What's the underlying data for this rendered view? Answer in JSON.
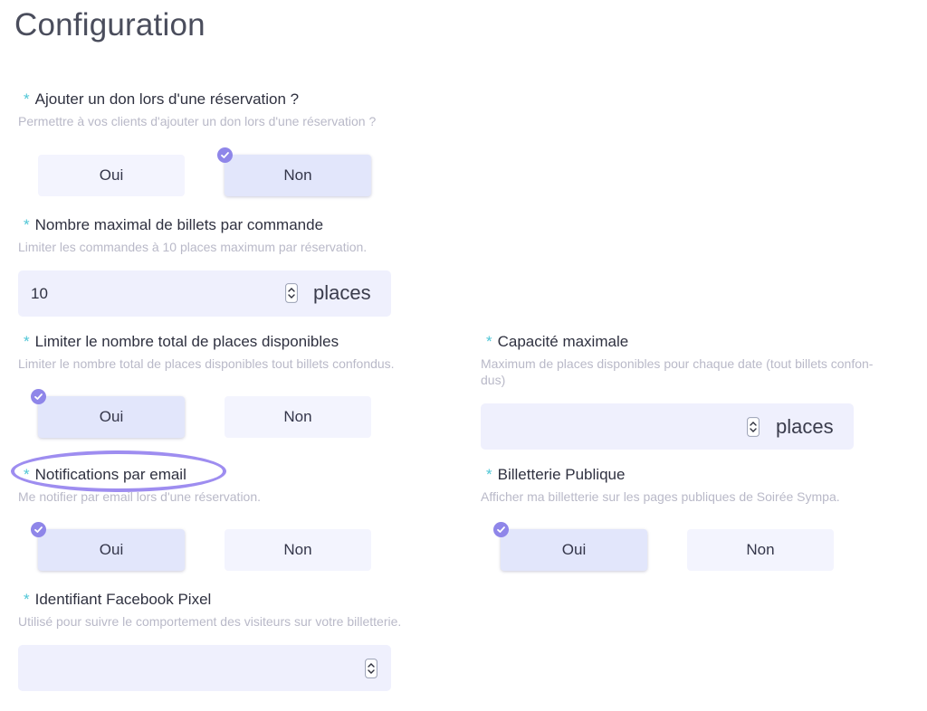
{
  "page": {
    "title": "Configuration"
  },
  "required_marker": "*",
  "donation": {
    "label": "Ajouter un don lors d'une réservation ?",
    "help": "Permettre à vos clients d'ajouter un don lors d'une réservation ?",
    "yes": "Oui",
    "no": "Non",
    "selected": "Non"
  },
  "max_tickets": {
    "label": "Nombre maximal de billets par commande",
    "help": "Limiter les commandes à 10 places maximum par réservation.",
    "value": "10",
    "unit": "places"
  },
  "limit_total": {
    "label": "Limiter le nombre total de places disponibles",
    "help": "Limiter le nombre total de places disponibles tout billets confondus.",
    "yes": "Oui",
    "no": "Non",
    "selected": "Oui"
  },
  "capacity": {
    "label": "Capacité maximale",
    "help_line1": "Maximum de places disponibles pour chaque date (tout billets confon-",
    "help_line2": "dus)",
    "value": "",
    "unit": "places"
  },
  "notifications": {
    "label": "Notifications par email",
    "help": "Me notifier par email lors d'une réservation.",
    "yes": "Oui",
    "no": "Non",
    "selected": "Oui"
  },
  "public_ticketing": {
    "label": "Billetterie Publique",
    "help": "Afficher ma billetterie sur les pages publiques de Soirée Sympa.",
    "yes": "Oui",
    "no": "Non",
    "selected": "Oui"
  },
  "facebook_pixel": {
    "label": "Identifiant Facebook Pixel",
    "help": "Utilisé pour suivre le comportement des visiteurs sur votre billetterie.",
    "value": ""
  },
  "colors": {
    "accent": "#8f86e9",
    "highlight_ellipse": "#9e8df0",
    "required_star": "#4fc6d6",
    "choice_bg": "#f3f4fe",
    "choice_selected_bg": "#e2e6fb",
    "input_bg": "#eff0fd"
  },
  "icons": {
    "check": "check-icon",
    "spinner": "spinner-arrows-icon"
  }
}
